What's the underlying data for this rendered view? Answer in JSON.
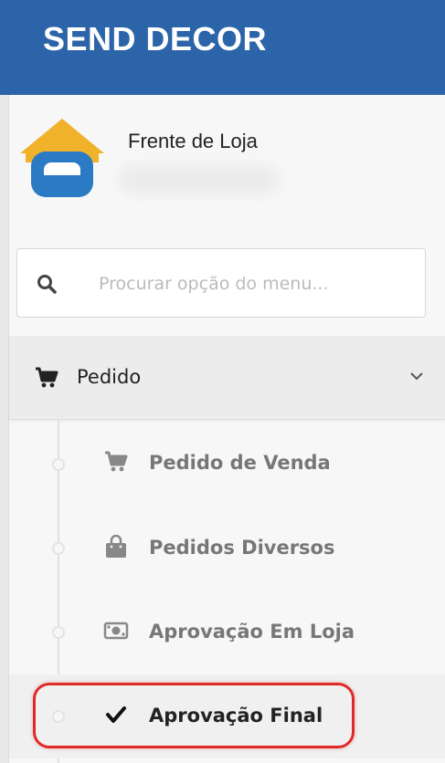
{
  "header": {
    "brand": "SEND DECOR"
  },
  "profile": {
    "company": "Frente de Loja"
  },
  "search": {
    "placeholder": "Procurar opção do menu..."
  },
  "menu": {
    "parent": {
      "label": "Pedido",
      "icon": "shopping-cart-icon"
    },
    "items": [
      {
        "label": "Pedido de Venda",
        "icon": "shopping-cart-icon"
      },
      {
        "label": "Pedidos Diversos",
        "icon": "shopping-bag-icon"
      },
      {
        "label": "Aprovação Em Loja",
        "icon": "money-bill-icon"
      },
      {
        "label": "Aprovação Final",
        "icon": "check-icon",
        "active": true
      }
    ]
  },
  "colors": {
    "header": "#2b64a8",
    "highlight": "#e02a2a",
    "logo_roof": "#f0b22a",
    "logo_sofa": "#2a7bc4"
  }
}
